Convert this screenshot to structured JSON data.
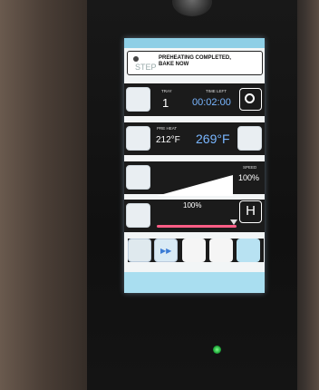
{
  "status": {
    "message_line1": "PREHEATING COMPLETED,",
    "message_line2": "BAKE NOW",
    "step_label": "STEP"
  },
  "timer_row": {
    "tray_label": "TRAY",
    "tray_value": "1",
    "time_left_label": "TIME LEFT",
    "time_value": "00:02:00"
  },
  "temp_row": {
    "label": "PRE HEAT",
    "current_temp": "212°F",
    "target_temp": "269°F"
  },
  "speed_row": {
    "label": "SPEED",
    "value": "100%",
    "level": 1.0
  },
  "fan_row": {
    "value": "100%",
    "level": 1.0,
    "button_label": "H"
  },
  "colors": {
    "screen_bg": "#f2f5f6",
    "accent_blue": "#79b6ff",
    "topbar": "#8ecfe6",
    "slider_pink": "#ff5d86",
    "led_green": "#1fa83a"
  }
}
